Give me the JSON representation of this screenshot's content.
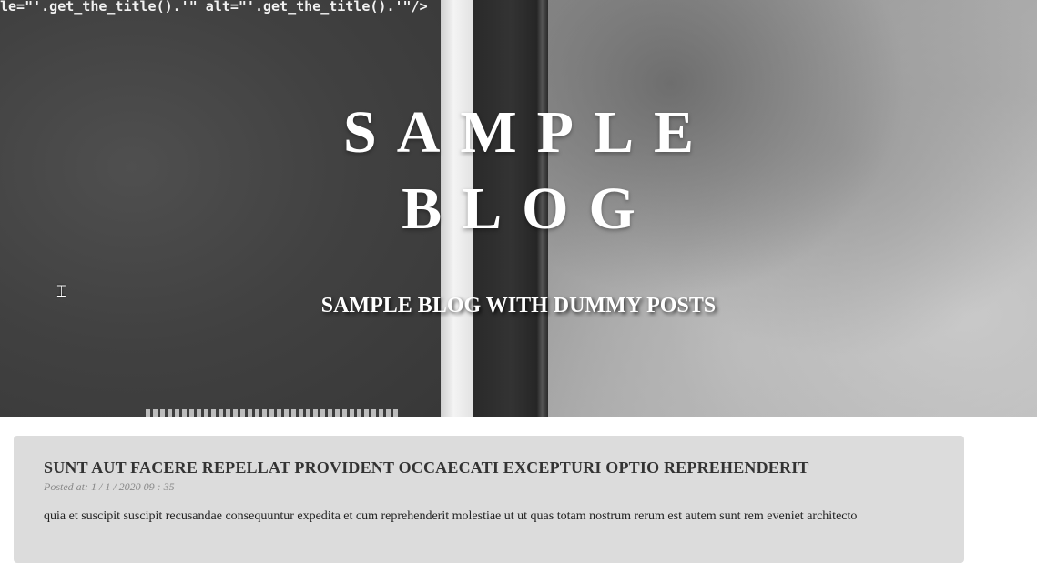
{
  "hero": {
    "code_snippet": "le=\"'.get_the_title().'\" alt=\"'.get_the_title().'\"/>",
    "title_line1": "SAMPLE",
    "title_line2": "BLOG",
    "subtitle": "SAMPLE BLOG WITH DUMMY POSTS"
  },
  "posts": [
    {
      "title": "SUNT AUT FACERE REPELLAT PROVIDENT OCCAECATI EXCEPTURI OPTIO REPREHENDERIT",
      "meta": "Posted at: 1 / 1 / 2020 09 : 35",
      "body": "quia et suscipit suscipit recusandae consequuntur expedita et cum reprehenderit molestiae ut ut quas totam nostrum rerum est autem sunt rem eveniet architecto"
    }
  ],
  "colors": {
    "card_background": "#dcdcdc",
    "title_text": "#333333",
    "meta_text": "#888888"
  },
  "icons": {
    "cursor": "text-cursor-icon"
  }
}
